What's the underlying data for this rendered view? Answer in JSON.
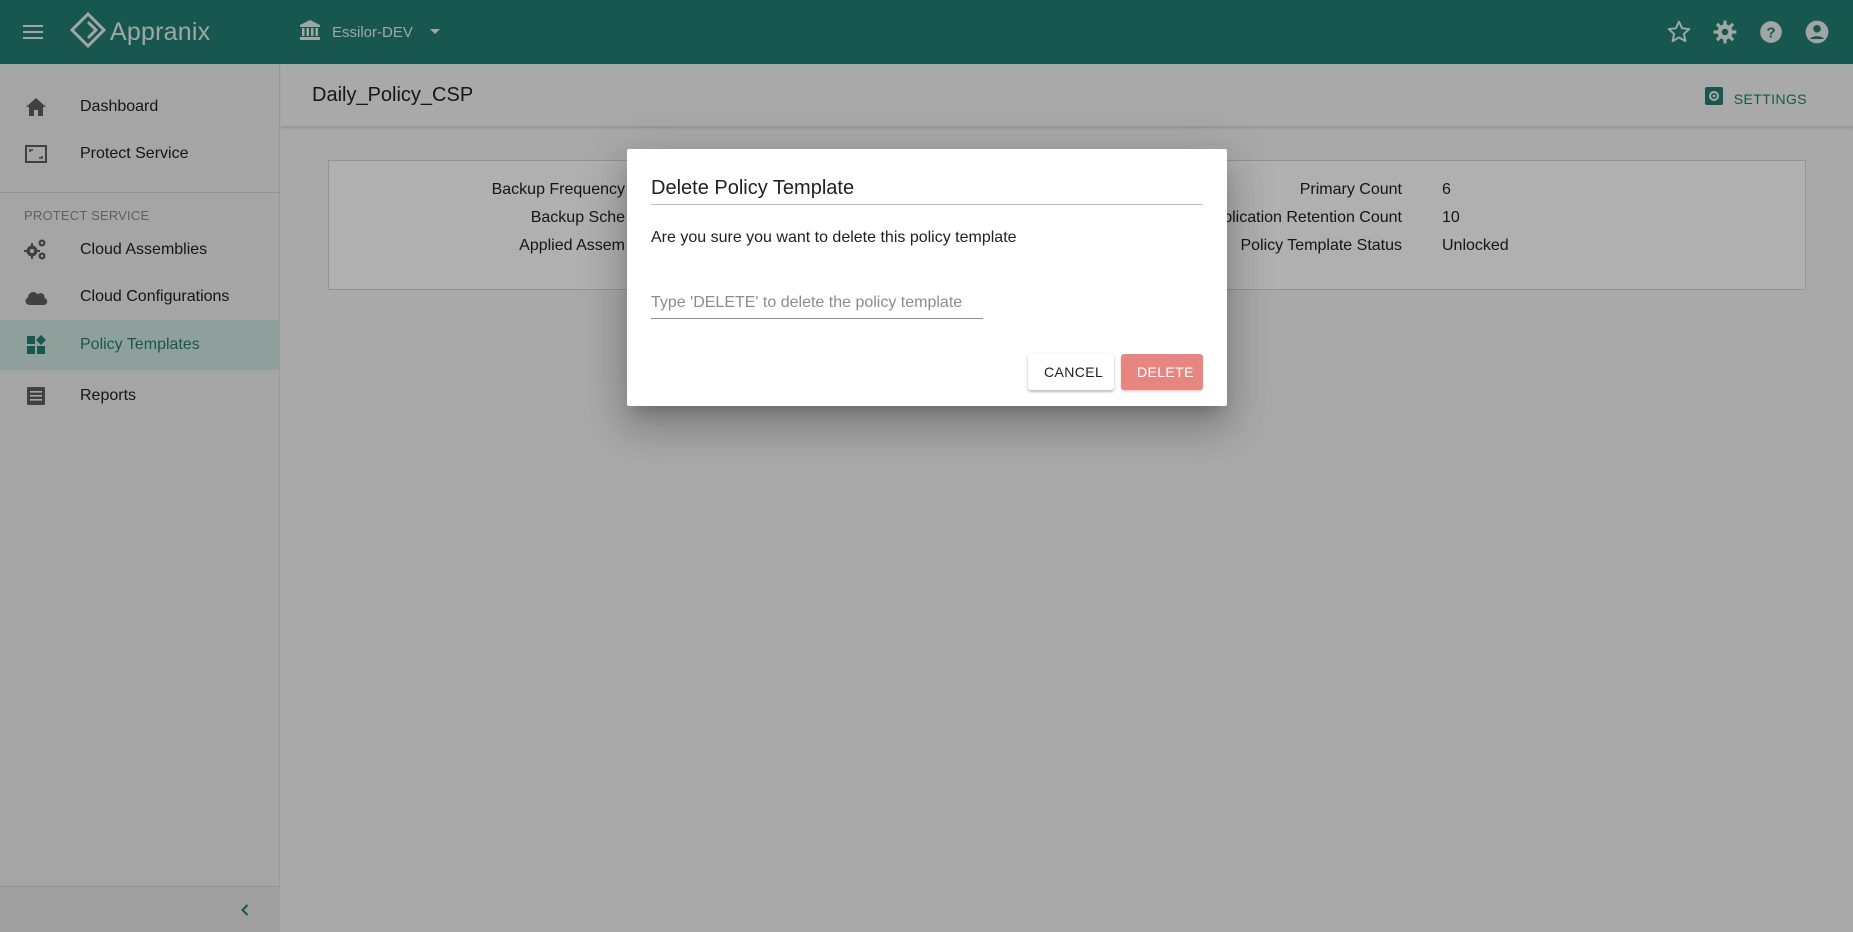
{
  "header": {
    "app_name": "Appranix",
    "org_name": "Essilor-DEV",
    "icons": [
      "menu-icon",
      "logo-icon",
      "bank-icon",
      "caret-down-icon",
      "star-icon",
      "gear-icon",
      "help-icon",
      "account-icon"
    ]
  },
  "sidebar": {
    "items": [
      {
        "label": "Dashboard",
        "icon": "home-icon"
      },
      {
        "label": "Protect Service",
        "icon": "frame-icon"
      }
    ],
    "section_label": "PROTECT SERVICE",
    "section_items": [
      {
        "label": "Cloud Assemblies",
        "icon": "gears-icon"
      },
      {
        "label": "Cloud Configurations",
        "icon": "cloud-icon"
      },
      {
        "label": "Policy Templates",
        "icon": "dashboard-grid-icon",
        "active": true
      },
      {
        "label": "Reports",
        "icon": "list-icon"
      }
    ]
  },
  "main": {
    "page_title": "Daily_Policy_CSP",
    "settings_label": "SETTINGS",
    "details_left": [
      {
        "key": "Backup Frequency"
      },
      {
        "key": "Backup Sche"
      },
      {
        "key": "Applied Assem"
      }
    ],
    "details_right": [
      {
        "key": "Primary Count",
        "value": "6"
      },
      {
        "key": "plication Retention Count",
        "value": "10"
      },
      {
        "key": "Policy Template Status",
        "value": "Unlocked"
      }
    ]
  },
  "dialog": {
    "title": "Delete Policy Template",
    "message": "Are you sure you want to delete this policy template",
    "input_placeholder": "Type 'DELETE' to delete the policy template",
    "input_value": "",
    "cancel_label": "CANCEL",
    "delete_label": "DELETE"
  },
  "colors": {
    "primary": "#237f73",
    "active_bg": "#cfe6e2",
    "delete_button": "#e67f7a"
  }
}
